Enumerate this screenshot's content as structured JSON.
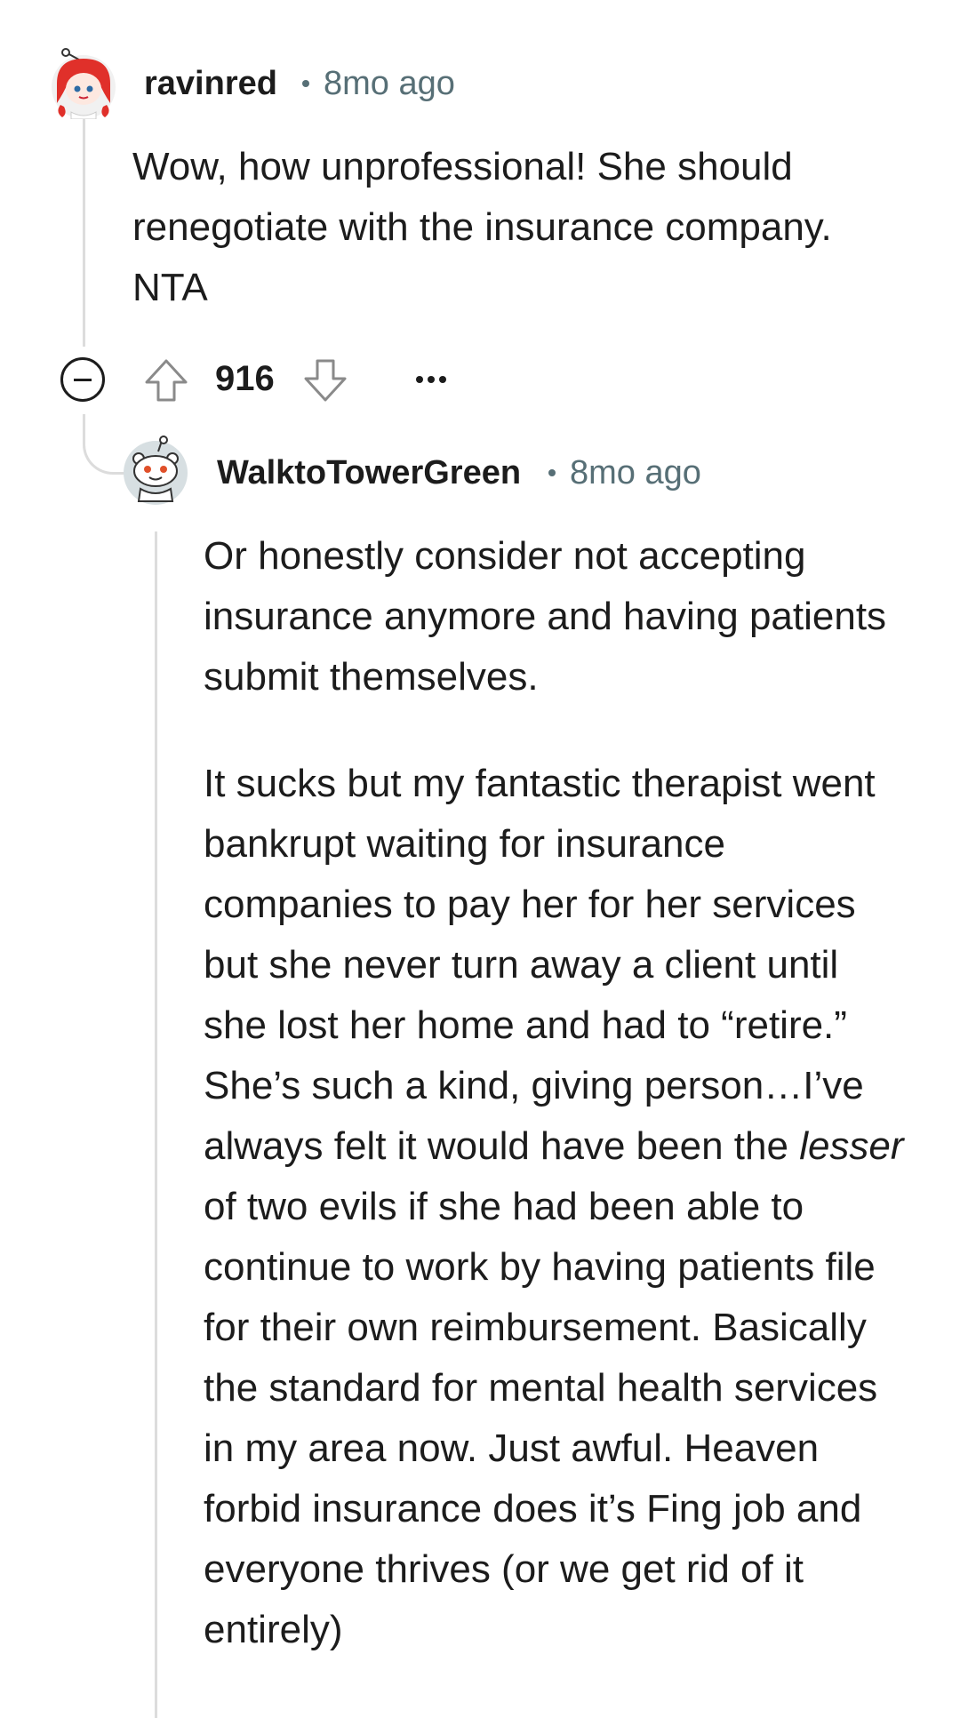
{
  "comments": [
    {
      "username": "ravinred",
      "time": "8mo ago",
      "avatar_icon": "snoo-red-hair-avatar",
      "paragraphs": [
        "Wow, how unprofessional! She should renegotiate with the insurance company. NTA"
      ],
      "score": "916",
      "actions": {
        "collapse_icon": "minus-circle-icon",
        "upvote_icon": "upvote-arrow-icon",
        "downvote_icon": "downvote-arrow-icon",
        "more_icon": "ellipsis-icon"
      }
    },
    {
      "username": "WalktoTowerGreen",
      "time": "8mo ago",
      "avatar_icon": "snoo-default-avatar",
      "paragraph1": "Or honestly consider not accepting insurance anymore and having patients submit themselves.",
      "paragraph2_before": "It sucks but my fantastic therapist went bankrupt waiting for insurance companies to pay her for her services but she never turn away a client until she lost her home and had to “retire.” She’s such a kind, giving person…I’ve always felt it would have been the ",
      "paragraph2_emphasis": "lesser",
      "paragraph2_after": " of two evils if she had been able to continue to work by having patients file for their own reimbursement. Basically the standard for mental health services in my area now. Just awful. Heaven forbid insurance does it’s Fing job and everyone thrives (or we get rid of it entirely)"
    }
  ],
  "colors": {
    "text": "#1c1c1c",
    "meta": "#576f76",
    "thread_line": "#dcdcdc",
    "avatar_red": "#e0302a"
  }
}
